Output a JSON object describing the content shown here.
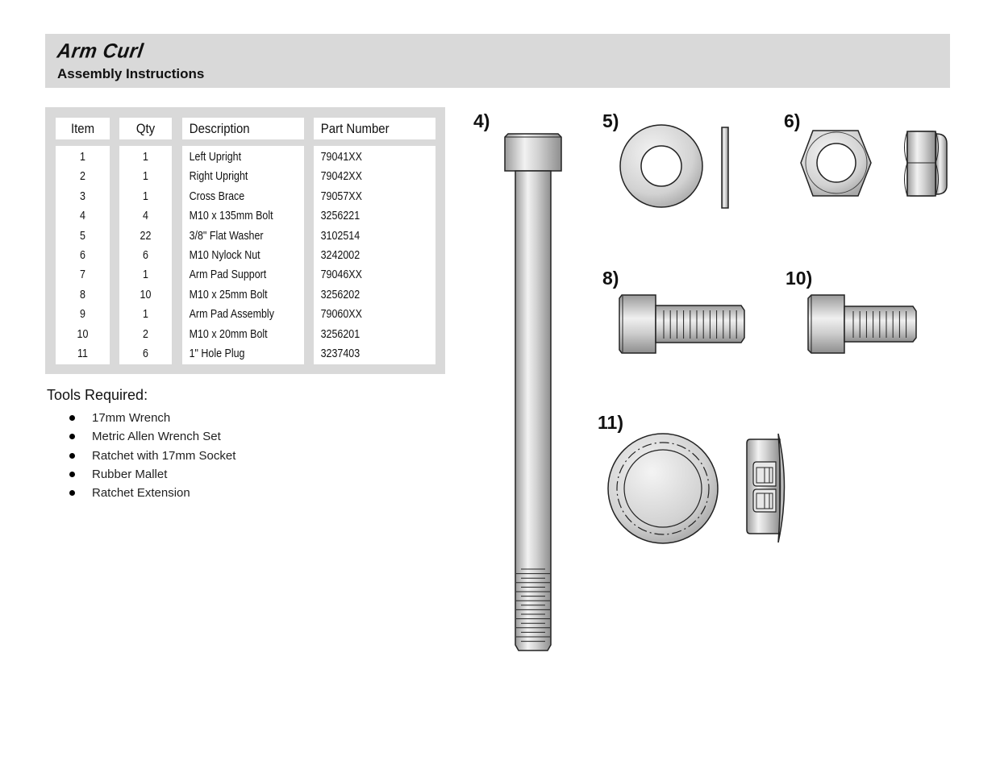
{
  "header": {
    "title": "Arm Curl",
    "subtitle": "Assembly Instructions"
  },
  "parts_table": {
    "columns": [
      "Item",
      "Qty",
      "Description",
      "Part Number"
    ],
    "rows": [
      {
        "item": "1",
        "qty": "1",
        "description": "Left Upright",
        "part_number": "79041XX"
      },
      {
        "item": "2",
        "qty": "1",
        "description": "Right Upright",
        "part_number": "79042XX"
      },
      {
        "item": "3",
        "qty": "1",
        "description": "Cross Brace",
        "part_number": "79057XX"
      },
      {
        "item": "4",
        "qty": "4",
        "description": "M10 x 135mm Bolt",
        "part_number": "3256221"
      },
      {
        "item": "5",
        "qty": "22",
        "description": "3/8\" Flat Washer",
        "part_number": "3102514"
      },
      {
        "item": "6",
        "qty": "6",
        "description": "M10 Nylock Nut",
        "part_number": "3242002"
      },
      {
        "item": "7",
        "qty": "1",
        "description": "Arm Pad Support",
        "part_number": "79046XX"
      },
      {
        "item": "8",
        "qty": "10",
        "description": "M10 x 25mm Bolt",
        "part_number": "3256202"
      },
      {
        "item": "9",
        "qty": "1",
        "description": "Arm Pad Assembly",
        "part_number": "79060XX"
      },
      {
        "item": "10",
        "qty": "2",
        "description": "M10 x 20mm Bolt",
        "part_number": "3256201"
      },
      {
        "item": "11",
        "qty": "6",
        "description": "1\" Hole Plug",
        "part_number": "3237403"
      }
    ]
  },
  "tools": {
    "title": "Tools Required:",
    "items": [
      "17mm Wrench",
      "Metric Allen Wrench Set",
      "Ratchet with 17mm Socket",
      "Rubber Mallet",
      "Ratchet Extension"
    ]
  },
  "figures": [
    {
      "label": "4)",
      "icon": "long-bolt-icon"
    },
    {
      "label": "5)",
      "icon": "flat-washer-icon"
    },
    {
      "label": "6)",
      "icon": "nylock-nut-icon"
    },
    {
      "label": "8)",
      "icon": "short-bolt-25mm-icon"
    },
    {
      "label": "10)",
      "icon": "short-bolt-20mm-icon"
    },
    {
      "label": "11)",
      "icon": "hole-plug-icon"
    }
  ]
}
